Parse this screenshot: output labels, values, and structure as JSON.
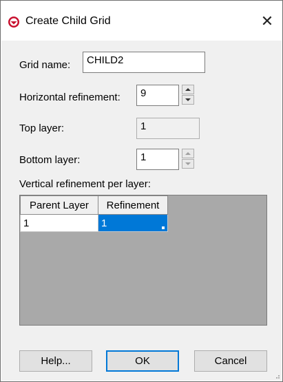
{
  "window": {
    "title": "Create Child Grid",
    "close_glyph": "✕"
  },
  "form": {
    "grid_name_label": "Grid name:",
    "grid_name_value": "CHILD2",
    "horizontal_refinement_label": "Horizontal refinement:",
    "horizontal_refinement_value": "9",
    "top_layer_label": "Top layer:",
    "top_layer_value": "1",
    "bottom_layer_label": "Bottom layer:",
    "bottom_layer_value": "1",
    "vertical_refinement_label": "Vertical refinement per layer:"
  },
  "table": {
    "columns": [
      "Parent Layer",
      "Refinement"
    ],
    "rows": [
      [
        "1",
        "1"
      ]
    ]
  },
  "buttons": {
    "help": "Help...",
    "ok": "OK",
    "cancel": "Cancel"
  },
  "colors": {
    "accent": "#0078d7",
    "icon_red": "#c8102e",
    "grid_bg": "#a9a9a9"
  }
}
